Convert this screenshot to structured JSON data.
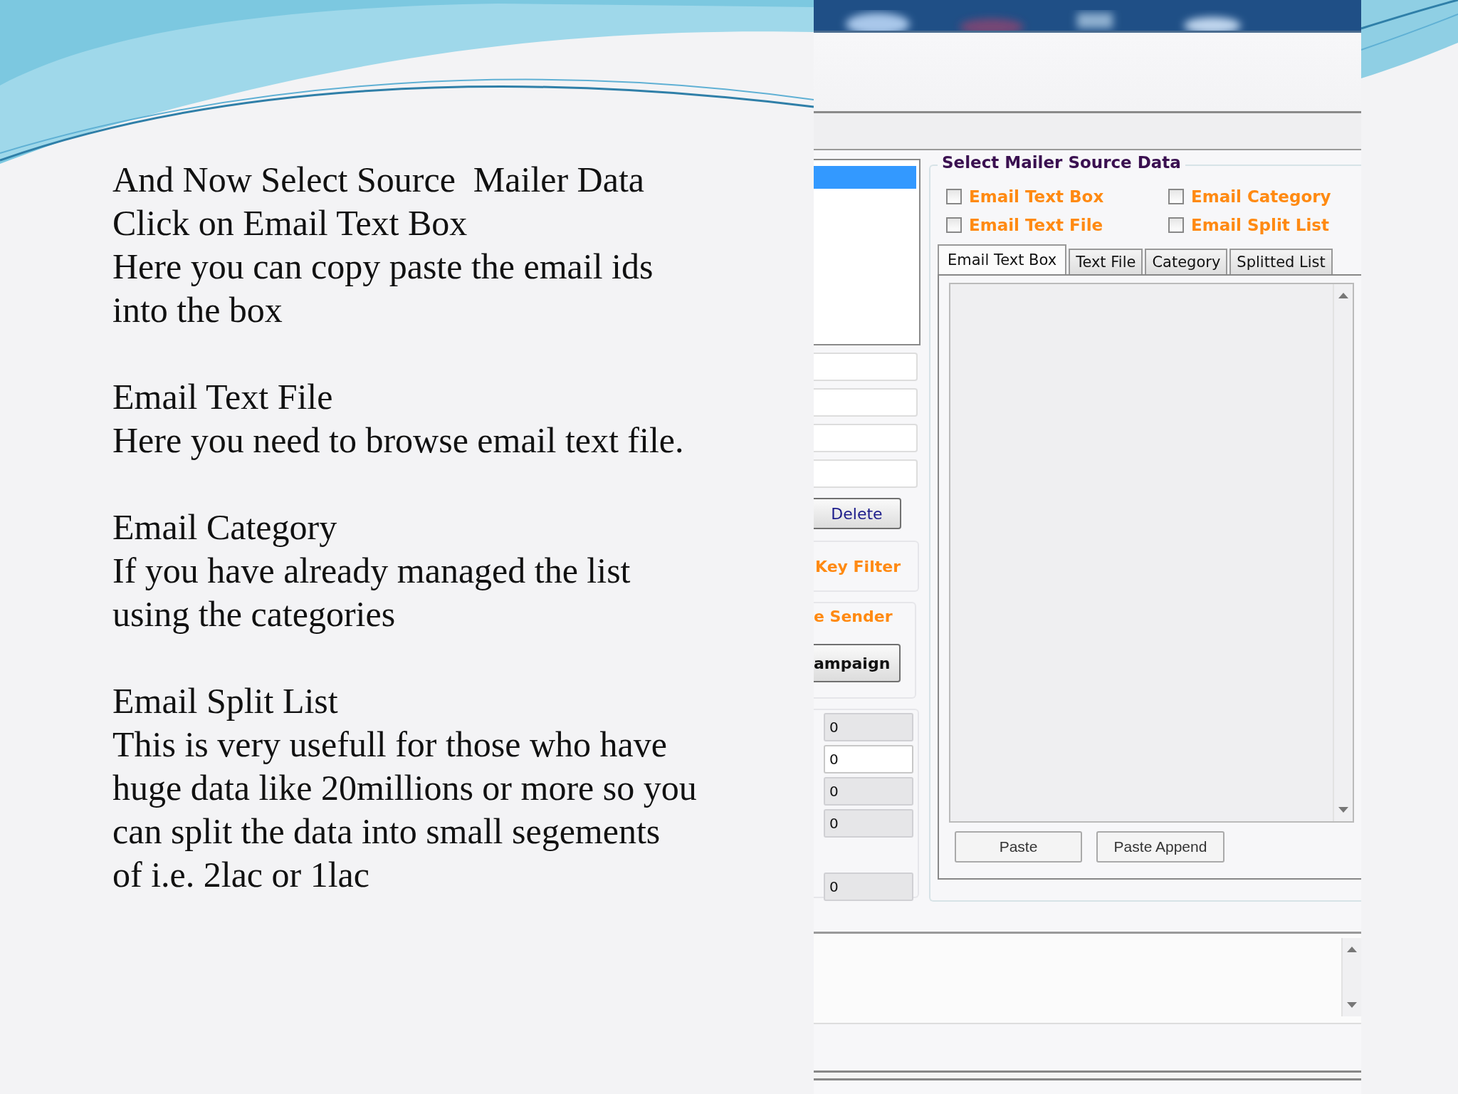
{
  "notes": [
    {
      "lines": [
        "And Now Select Source  Mailer Data",
        "Click on Email Text Box",
        "Here you can copy paste the email ids",
        "into the box"
      ]
    },
    {
      "lines": [
        "Email Text File",
        "Here you need to browse email text file."
      ]
    },
    {
      "lines": [
        "Email Category",
        "If you have already managed the list",
        "using the categories"
      ]
    },
    {
      "lines": [
        "Email Split List",
        "This is very usefull for those who have",
        "huge data like 20millions or more so you",
        "can split the data into small segements",
        "of i.e. 2lac or 1lac"
      ]
    }
  ],
  "app": {
    "list_items": [
      {
        "selected": true
      }
    ],
    "delete_button": "Delete",
    "key_filter_group": "Key Filter",
    "sender_group": "e Sender",
    "campaign_button": "ampaign",
    "counters": [
      {
        "value": "0",
        "readonly": true
      },
      {
        "value": "0",
        "readonly": false
      },
      {
        "value": "0",
        "readonly": true
      },
      {
        "value": "0",
        "readonly": true
      },
      {
        "value": "0",
        "readonly": true
      }
    ],
    "source_data": {
      "legend": "Select Mailer Source Data",
      "options": [
        {
          "label": "Email Text Box",
          "checked": false
        },
        {
          "label": "Email Category",
          "checked": false
        },
        {
          "label": "Email Text File",
          "checked": false
        },
        {
          "label": "Email Split List",
          "checked": false
        }
      ],
      "tabs": [
        {
          "label": "Email Text Box",
          "selected": true
        },
        {
          "label": "Text File",
          "selected": false
        },
        {
          "label": "Category",
          "selected": false
        },
        {
          "label": "Splitted List",
          "selected": false
        }
      ],
      "buttons": [
        "Paste",
        "Paste Append"
      ]
    }
  }
}
